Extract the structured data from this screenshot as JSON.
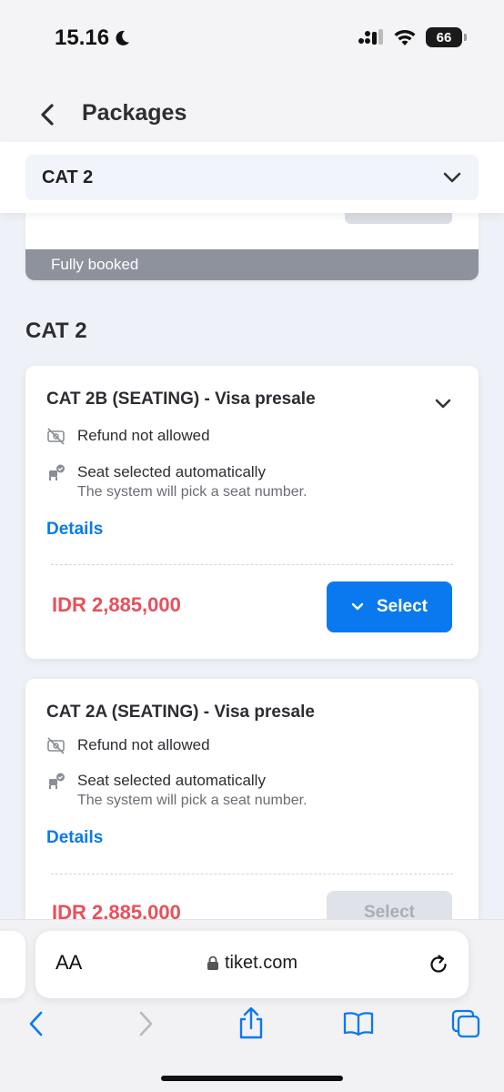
{
  "status": {
    "time": "15.16",
    "battery": "66"
  },
  "header": {
    "title": "Packages"
  },
  "category_select": {
    "selected": "CAT 2"
  },
  "previous_card": {
    "banner": "Fully booked"
  },
  "section": {
    "title": "CAT 2"
  },
  "packages": [
    {
      "name": "CAT 2B (SEATING) - Visa presale",
      "refund": "Refund not allowed",
      "seat": "Seat selected automatically",
      "seat_sub": "The system will pick a seat number.",
      "details": "Details",
      "price": "IDR 2,885,000",
      "select": "Select"
    },
    {
      "name": "CAT 2A (SEATING) - Visa presale",
      "refund": "Refund not allowed",
      "seat": "Seat selected automatically",
      "seat_sub": "The system will pick a seat number.",
      "details": "Details",
      "price": "IDR 2,885,000",
      "select": "Select"
    }
  ],
  "browser": {
    "aa": "AA",
    "url": "tiket.com"
  },
  "colors": {
    "accent": "#0a79f0",
    "price": "#e8505b",
    "link": "#0a7ae8",
    "banner": "#8e929c"
  }
}
